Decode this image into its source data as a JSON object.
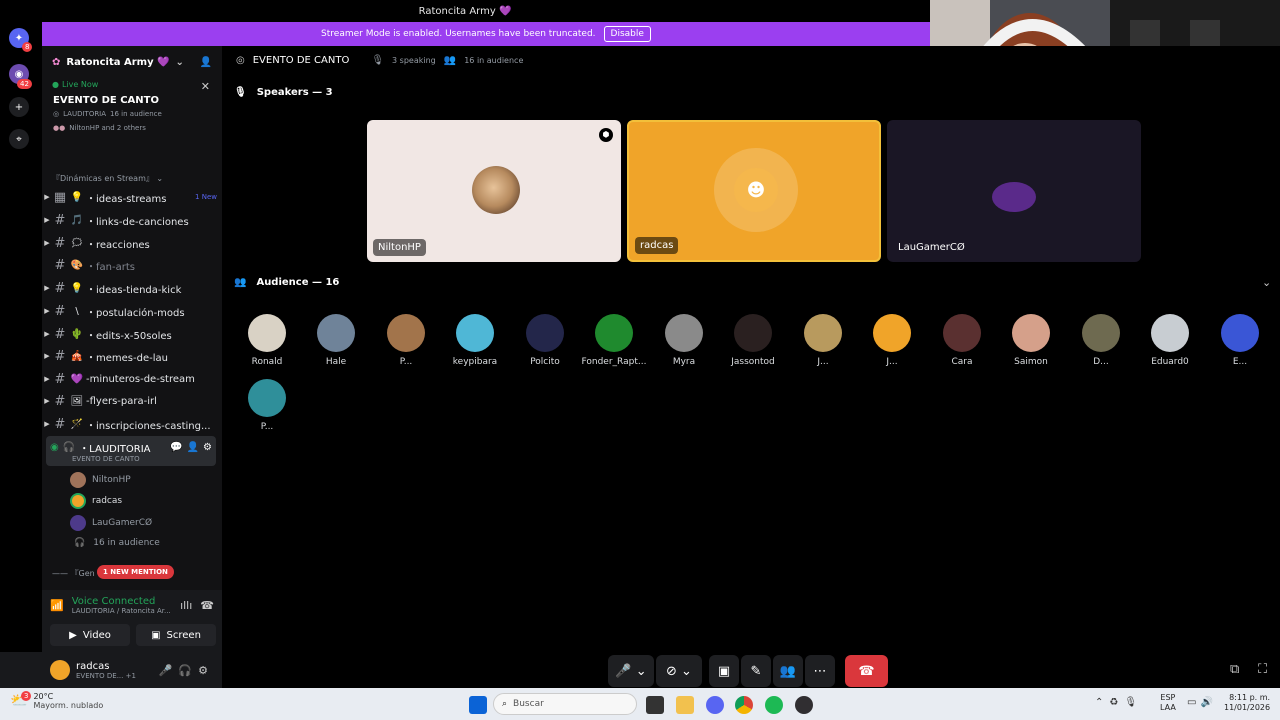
{
  "window": {
    "title": "Ratoncita Army 💜"
  },
  "rail": {
    "discord_badge": "8",
    "server_badge": "42"
  },
  "banner": {
    "text": "Streamer Mode is enabled. Usernames have been truncated.",
    "button": "Disable"
  },
  "server": {
    "name": "Ratoncita Army 💜"
  },
  "live": {
    "label": "Live Now",
    "event": "EVENTO DE CANTO",
    "channel": "LAUDITORIA",
    "audience": "16 in audience",
    "participants": "NiltonHP and 2 others"
  },
  "category": {
    "name": "『Dinámicas en Stream』"
  },
  "channels": [
    {
      "emoji": "💡",
      "name": "・ideas-streams",
      "badge": "1 New"
    },
    {
      "emoji": "🎵",
      "name": "・links-de-canciones"
    },
    {
      "emoji": "🗯",
      "name": "・reacciones"
    },
    {
      "emoji": "🎨",
      "name": "・fan-arts"
    },
    {
      "emoji": "💡",
      "name": "・ideas-tienda-kick"
    },
    {
      "emoji": "\\",
      "name": "・postulación-mods"
    },
    {
      "emoji": "🌵",
      "name": "・edits-x-50soles"
    },
    {
      "emoji": "🎪",
      "name": "・memes-de-lau"
    },
    {
      "emoji": "💜",
      "name": "-minuteros-de-stream"
    },
    {
      "emoji": "🖼",
      "name": "-flyers-para-irl"
    },
    {
      "emoji": "🪄",
      "name": "・inscripciones-casting..."
    }
  ],
  "stage_channel": {
    "name": "・LAUDITORIA",
    "topic": "EVENTO DE CANTO",
    "members": [
      "NiltonHP",
      "radcas",
      "LauGamerCØ"
    ],
    "audience": "16 in audience"
  },
  "mention": {
    "prefix": "『Gen",
    "label": "1 NEW MENTION"
  },
  "voice": {
    "status": "Voice Connected",
    "location": "LAUDITORIA / Ratoncita Ar...",
    "video": "Video",
    "screen": "Screen"
  },
  "user": {
    "name": "radcas",
    "status": "EVENTO DE...",
    "extra": "+1"
  },
  "header": {
    "title": "EVENTO DE CANTO",
    "speaking": "3 speaking",
    "audience": "16 in audience"
  },
  "speakers": {
    "title": "Speakers — 3",
    "list": [
      "NiltonHP",
      "radcas",
      "LauGamerCØ"
    ]
  },
  "audience": {
    "title": "Audience — 16",
    "list": [
      "Ronald",
      "Hale",
      "P...",
      "keypibara",
      "Polcito",
      "Fonder_Rapt...",
      "Myra",
      "Jassontod",
      "J...",
      "J...",
      "Cara",
      "Saimon",
      "D...",
      "Eduard0",
      "E...",
      "P..."
    ]
  },
  "taskbar": {
    "weather_temp": "20°C",
    "weather_desc": "Mayorm. nublado",
    "weather_badge": "3",
    "search": "Buscar",
    "lang1": "ESP",
    "lang2": "LAA",
    "time": "8:11 p. m.",
    "date": "11/01/2026"
  },
  "colors": {
    "accent": "#9b3ff0",
    "speaking_border": "#f3c03a",
    "radcas_bg": "#f0a429",
    "hangup": "#da373c",
    "voice_green": "#23a55a"
  }
}
